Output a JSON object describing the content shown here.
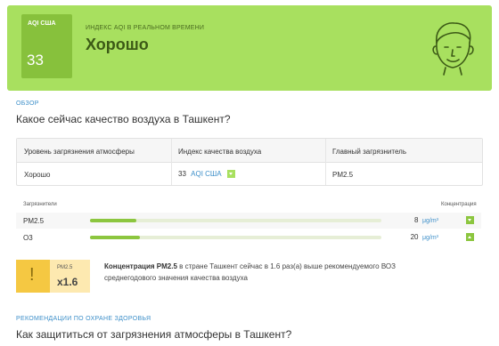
{
  "banner": {
    "aqi_label": "AQI США",
    "aqi_value": "33",
    "subtitle": "ИНДЕКС AQI В РЕАЛЬНОМ ВРЕМЕНИ",
    "status": "Хорошо",
    "color": "#a8e05f"
  },
  "overview": {
    "label": "ОБЗОР",
    "question": "Какое сейчас качество воздуха в Ташкент?"
  },
  "summary_table": {
    "headers": [
      "Уровень загрязнения атмосферы",
      "Индекс качества воздуха",
      "Главный загрязнитель"
    ],
    "level": "Хорошо",
    "aqi_value": "33",
    "aqi_unit": "AQI США",
    "pollutant": "PM2.5"
  },
  "pollutants": {
    "header_left": "Загрязнители",
    "header_right": "Концентрация",
    "items": [
      {
        "name": "PM2.5",
        "value": "8",
        "unit": "μg/m³",
        "level_fraction": 0.16,
        "trend": "down"
      },
      {
        "name": "O3",
        "value": "20",
        "unit": "μg/m³",
        "level_fraction": 0.17,
        "trend": "up"
      }
    ]
  },
  "warning": {
    "icon": "!",
    "pollutant": "PM2.5",
    "factor": "x1.6",
    "text_bold": "Концентрация PM2.5",
    "text_rest": " в стране Ташкент сейчас в 1.6 раз(а) выше рекомендуемого ВОЗ среднегодового значения качества воздуха"
  },
  "health": {
    "label": "РЕКОМЕНДАЦИИ ПО ОХРАНЕ ЗДОРОВЬЯ",
    "question": "Как защититься от загрязнения атмосферы в Ташкент?"
  }
}
